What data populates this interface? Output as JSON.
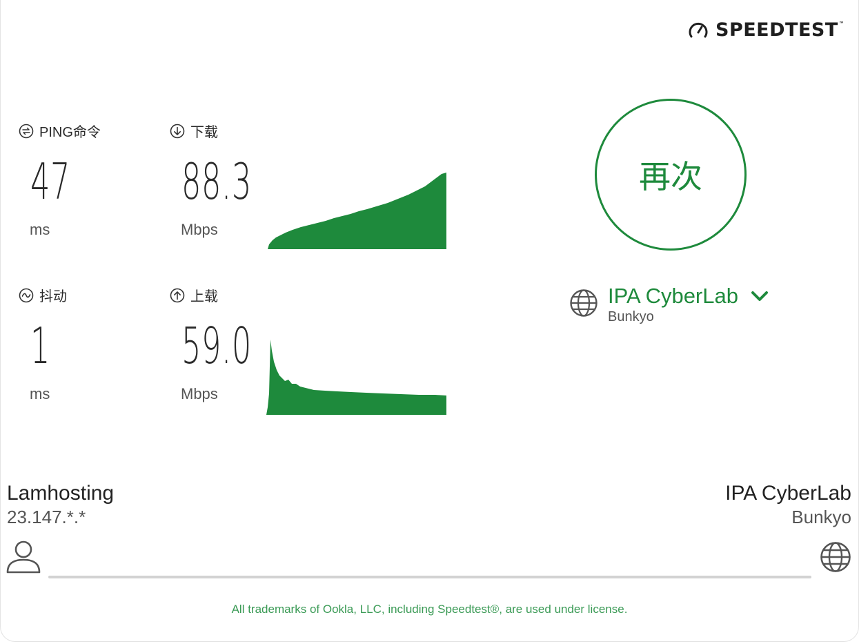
{
  "brand": {
    "name": "SPEEDTEST",
    "trademark": "™"
  },
  "metrics": {
    "ping": {
      "label": "PING命令",
      "value": "47",
      "unit": "ms",
      "icon": "ping-icon"
    },
    "download": {
      "label": "下载",
      "value": "88.3",
      "unit": "Mbps",
      "icon": "download-arrow-icon"
    },
    "jitter": {
      "label": "抖动",
      "value": "1",
      "unit": "ms",
      "icon": "jitter-wave-icon"
    },
    "upload": {
      "label": "上载",
      "value": "59.0",
      "unit": "Mbps",
      "icon": "upload-arrow-icon"
    }
  },
  "again_button": {
    "label": "再次"
  },
  "server": {
    "name": "IPA CyberLab",
    "city": "Bunkyo"
  },
  "client": {
    "isp": "Lamhosting",
    "ip": "23.147.*.*"
  },
  "host": {
    "name": "IPA CyberLab",
    "city": "Bunkyo"
  },
  "footer": "All trademarks of Ookla, LLC, including Speedtest®, are used under license.",
  "colors": {
    "accent": "#1e8a3c",
    "graph_fill": "#1e8a3c"
  }
}
